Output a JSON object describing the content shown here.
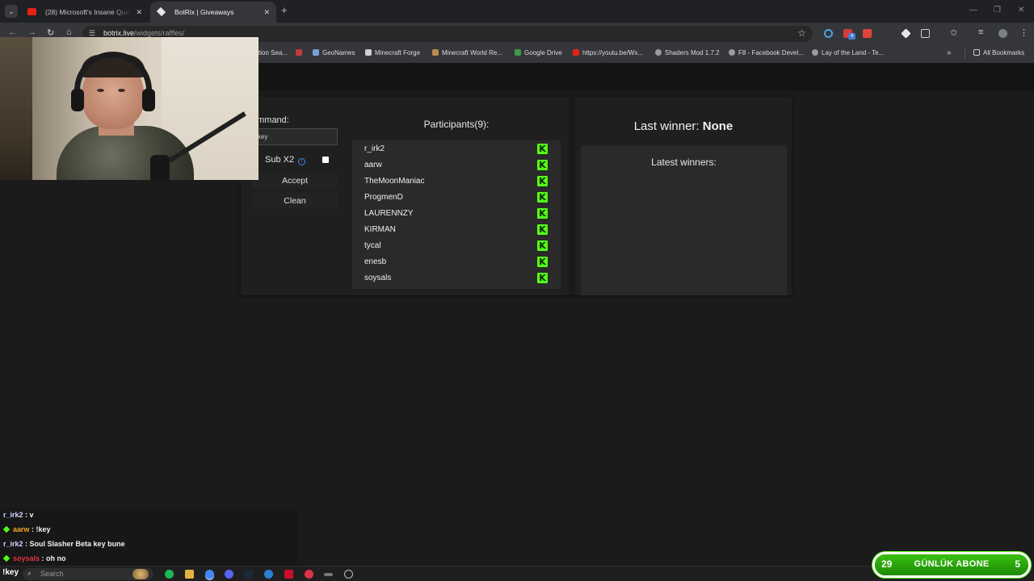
{
  "browser": {
    "tabs": [
      {
        "title": "(28) Microsoft's Insane Quantum",
        "active": false,
        "favicon": "youtube-icon"
      },
      {
        "title": "BotRix | Giveaways",
        "active": true,
        "favicon": "botrix-icon"
      }
    ],
    "url_host": "botrix.live",
    "url_path": "/widgets/raffles/",
    "bookmarks": [
      {
        "label": "tion Sea...",
        "icon": "bookmark-icon"
      },
      {
        "label": "",
        "icon": "x-icon"
      },
      {
        "label": "GeoNames",
        "icon": "geonames-icon"
      },
      {
        "label": "Minecraft Forge",
        "icon": "anvil-icon"
      },
      {
        "label": "Minecraft World Re...",
        "icon": "bottle-icon"
      },
      {
        "label": "Google Drive",
        "icon": "google-drive-icon"
      },
      {
        "label": "https://youtu.be/Wx...",
        "icon": "youtube-icon"
      },
      {
        "label": "Shaders Mod 1.7.2",
        "icon": "globe-icon"
      },
      {
        "label": "F8 - Facebook Devel...",
        "icon": "globe-icon"
      },
      {
        "label": "Lay of the Land - Te...",
        "icon": "globe-icon"
      }
    ],
    "all_bookmarks_label": "All Bookmarks"
  },
  "raffle": {
    "command_label": "ommand:",
    "command_value": "key",
    "sub_label": "Sub X2",
    "sub_checked": false,
    "accept_label": "Accept",
    "clean_label": "Clean",
    "participants_title": "Participants(9):",
    "participants": [
      "r_irk2",
      "aarw",
      "TheMoonManiac",
      "ProgmenD",
      "LAURENNZY",
      "KIRMAN",
      "tycal",
      "enesb",
      "soysals"
    ],
    "participant_platform_icon": "kick-icon",
    "last_winner_label": "Last winner: ",
    "last_winner_value": "None",
    "latest_winners_title": "Latest winners:"
  },
  "chat": [
    {
      "user": "r_irk2",
      "message": " : v",
      "badge": false,
      "color": "#cfd8ff"
    },
    {
      "user": "aarw",
      "message": " : !key",
      "badge": true,
      "color": "#f5a623"
    },
    {
      "user": "r_irk2",
      "message": " : Soul Slasher Beta key bune",
      "badge": false,
      "color": "#cfd8ff"
    },
    {
      "user": "soysals",
      "message": " : oh no",
      "badge": true,
      "color": "#e8333a"
    }
  ],
  "taskbar": {
    "key_text": "!key",
    "search_placeholder": "Search"
  },
  "sub_goal": {
    "current": "29",
    "label": "GÜNLÜK ABONE",
    "target": "5",
    "accent": "#53fc18"
  }
}
